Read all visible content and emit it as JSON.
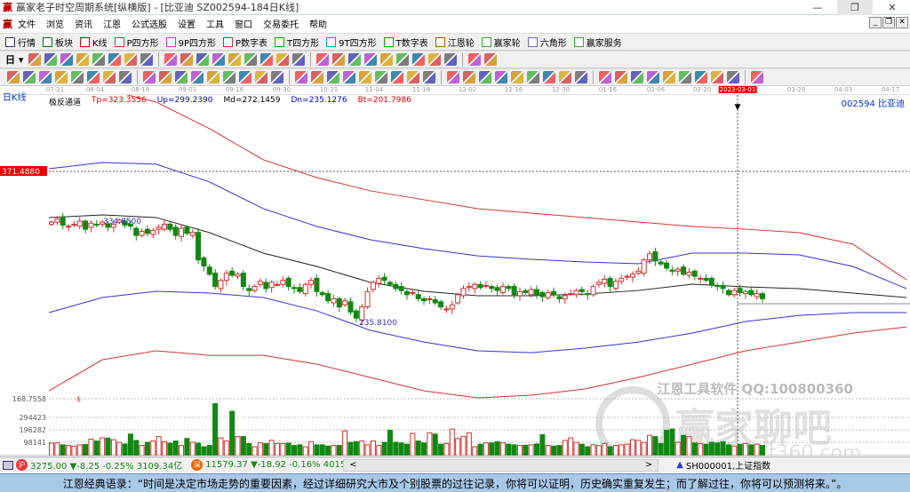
{
  "window": {
    "title": "赢家老子时空周期系统[纵横版] - [比亚迪  SZ002594-184日K线]",
    "minimize": "—",
    "restore": "❐",
    "close": "✕"
  },
  "menu": {
    "items": [
      "文件",
      "浏览",
      "资讯",
      "江恩",
      "公式选股",
      "设置",
      "工具",
      "窗口",
      "交易委托",
      "帮助"
    ],
    "mdi": [
      "_",
      "❐",
      "✕"
    ]
  },
  "toolbar1": [
    "行情",
    "板块",
    "K线",
    "P四方形",
    "9P四方形",
    "P数字表",
    "T四方形",
    "9T四方形",
    "T数字表",
    "江恩轮",
    "赢家轮",
    "六角形",
    "赢家服务"
  ],
  "toolbar2_period": "日",
  "icons2": [
    "period-icon",
    "chart-type-icon",
    "info-icon",
    "indicator-icon",
    "indicator2-icon",
    "candle-icon",
    "weight-icon",
    "color-icon",
    "first-icon",
    "last-icon",
    "prev-icon",
    "next-icon",
    "diamond1-icon",
    "diamond2-icon",
    "diamond3-icon",
    "diamond4-icon",
    "diamond5-icon",
    "diamond6-icon",
    "hand-icon",
    "crosshair-icon",
    "line-icon",
    "gift-icon",
    "calc-icon",
    "calendar-icon",
    "table-icon",
    "form-icon",
    "save-icon",
    "truck-icon"
  ],
  "icons3": [
    "pen-icon",
    "lines-icon",
    "gold1-icon",
    "gold2-icon",
    "fib-icon",
    "wave-icon",
    "eraser-icon",
    "circle-icon",
    "grid-icon",
    "n2-icon",
    "angle-icon",
    "target-icon",
    "star-icon",
    "box-icon",
    "speed-icon",
    "fan-icon",
    "gann-icon",
    "bars-icon",
    "cycle-icon",
    "rect-icon",
    "fan2-icon",
    "square-icon",
    "square2-icon",
    "arc-icon",
    "v-icon",
    "grid2-icon",
    "grid3-icon",
    "parallel-icon",
    "channel-icon",
    "percent-sign-icon",
    "percent-icon",
    "pct-line-icon",
    "gold-circle-icon",
    "gold-line-icon",
    "pen2-icon",
    "triangle-icon",
    "gold3-icon",
    "angle2-icon",
    "f-icon",
    "angle3-icon",
    "angle4-icon",
    "angle5-icon",
    "angle6-icon",
    "taiji-icon",
    "infinity-icon"
  ],
  "chart": {
    "period_label": "日K线",
    "indicator": {
      "name": "极反通道",
      "tp": "Tp=323.3556",
      "up": "Up=299.2390",
      "md": "Md=272.1459",
      "dn": "Dn=235.1276",
      "bt": "Bt=201.7986"
    },
    "stock": "002594  比亚迪",
    "dates": [
      "07-21",
      "08-04",
      "08-18",
      "09-01",
      "09-16",
      "09-30",
      "10-21",
      "11-04",
      "11-18",
      "12-02",
      "12-16",
      "12-30",
      "01-16",
      "02-06",
      "02-20",
      "2023-03-01",
      "03-20",
      "04-03",
      "04-17"
    ],
    "price_labels": {
      "high_line": "371.4880",
      "max_mark": "334.8500",
      "min_mark": "235.8100",
      "vol_top": "168.7558"
    },
    "vol_ticks": [
      "294423",
      "196282",
      "98141"
    ],
    "watermark": "江恩工具软件  QQ:100800360",
    "watermark2": "赢家聊吧",
    "watermark3": "jiaoba.yict360.com"
  },
  "chart_data": {
    "type": "candlestick",
    "closes": [
      333,
      336,
      330,
      329,
      331,
      334,
      326,
      332,
      330,
      333,
      328,
      331,
      335,
      330,
      329,
      320,
      324,
      322,
      325,
      328,
      331,
      326,
      320,
      327,
      322,
      323,
      296,
      290,
      282,
      270,
      276,
      283,
      281,
      282,
      270,
      266,
      270,
      275,
      268,
      274,
      272,
      276,
      270,
      268,
      265,
      272,
      276,
      265,
      262,
      256,
      258,
      250,
      256,
      245,
      239,
      250,
      265,
      274,
      278,
      276,
      272,
      268,
      266,
      262,
      264,
      258,
      256,
      258,
      254,
      250,
      248,
      252,
      262,
      268,
      270,
      272,
      269,
      271,
      268,
      266,
      270,
      268,
      262,
      265,
      264,
      267,
      262,
      260,
      264,
      262,
      258,
      261,
      263,
      266,
      265,
      262,
      270,
      274,
      277,
      270,
      275,
      278,
      280,
      282,
      285,
      296,
      302,
      295,
      292,
      288,
      285,
      287,
      282,
      284,
      280,
      278,
      276,
      272,
      270,
      268,
      262,
      266,
      264,
      265,
      262,
      263,
      258
    ],
    "volumes": [
      98,
      100,
      85,
      80,
      75,
      85,
      88,
      130,
      115,
      140,
      138,
      125,
      105,
      92,
      170,
      120,
      80,
      105,
      115,
      150,
      110,
      98,
      115,
      80,
      135,
      105,
      98,
      70,
      80,
      410,
      140,
      115,
      350,
      150,
      150,
      95,
      70,
      100,
      95,
      120,
      95,
      95,
      98,
      80,
      85,
      70,
      110,
      85,
      85,
      75,
      80,
      80,
      195,
      105,
      110,
      115,
      85,
      115,
      80,
      105,
      200,
      105,
      100,
      90,
      175,
      115,
      100,
      180,
      170,
      90,
      95,
      210,
      135,
      150,
      180,
      70,
      90,
      100,
      100,
      110,
      100,
      90,
      85,
      80,
      82,
      85,
      92,
      165,
      80,
      75,
      80,
      120,
      140,
      105,
      90,
      70,
      85,
      80,
      95,
      70,
      80,
      85,
      90,
      125,
      120,
      105,
      160,
      150,
      95,
      200,
      210,
      105,
      160,
      150,
      100,
      95,
      90,
      105,
      100,
      110,
      85,
      75,
      90,
      95,
      85,
      90,
      80
    ],
    "bands": {
      "tp": [
        478.4,
        463.6,
        450.6,
        424.5,
        394.0,
        376.6,
        363.6,
        354.9,
        346.2,
        341.8,
        337.5,
        333.1,
        328.8,
        326.1,
        322.7,
        311.4,
        276.6
      ],
      "up": [
        385.3,
        391.4,
        389.7,
        372.3,
        346.2,
        328.8,
        315.7,
        307.0,
        300.0,
        296.6,
        294.0,
        292.2,
        302.7,
        302.7,
        300.9,
        289.6,
        267.9
      ],
      "md": [
        337.5,
        340.1,
        337.5,
        322.7,
        302.7,
        289.6,
        274.0,
        265.3,
        260.9,
        260.9,
        262.6,
        266.1,
        272.2,
        269.6,
        267.9,
        263.5,
        259.2
      ],
      "dn": [
        244.4,
        259.2,
        265.3,
        263.5,
        259.2,
        246.1,
        227.0,
        215.6,
        207.0,
        205.2,
        209.6,
        215.6,
        224.3,
        235.7,
        241.7,
        244.4,
        244.4
      ],
      "bt": [
        167.8,
        198.3,
        207.0,
        202.6,
        202.6,
        193.9,
        180.9,
        167.8,
        160.9,
        163.5,
        169.6,
        180.9,
        193.9,
        207.0,
        215.6,
        224.3,
        230.4
      ]
    },
    "colors": {
      "up": "#d03030",
      "down": "#118811",
      "tp": "#cc3333",
      "up_band": "#3333cc",
      "md": "#222222",
      "dn": "#3333cc",
      "bt": "#cc3333"
    }
  },
  "status": {
    "sh_badge": "沪",
    "sh": "3275.00 ▼-8.25 -0.25% 3109.34亿",
    "sz_badge": "深",
    "sz": "11579.37 ▼-18.92 -0.16% 4015.38",
    "scroll_left": "<",
    "scroll_right": ">",
    "index": "SH000001,上证指数"
  },
  "quote": "江恩经典语录：“时间是决定市场走势的重要因素，经过详细研究大市及个别股票的过往记录，你将可以证明，历史确实重复发生；而了解过往，你将可以预测将来。”。"
}
